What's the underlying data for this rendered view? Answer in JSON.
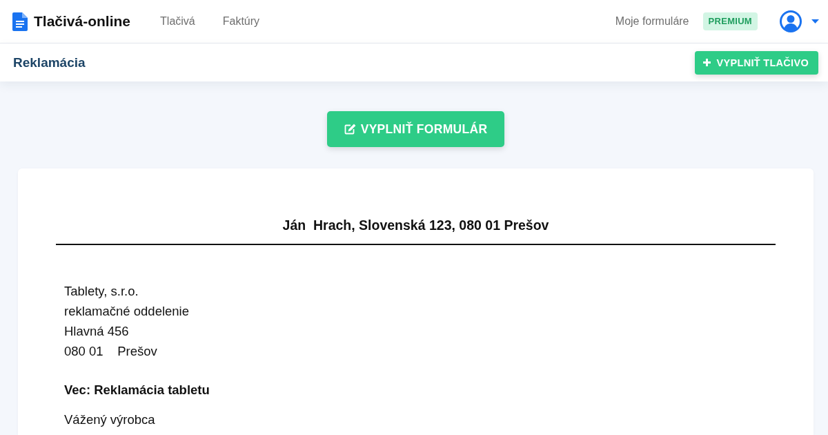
{
  "navbar": {
    "brand": "Tlačivá-online",
    "links": [
      {
        "label": "Tlačivá"
      },
      {
        "label": "Faktúry"
      }
    ],
    "my_forms": "Moje formuláre",
    "badge": "PREMIUM"
  },
  "subheader": {
    "title": "Reklamácia",
    "button": "VYPLNIŤ TLAČIVO"
  },
  "fill_button": "VYPLNIŤ FORMULÁR",
  "document": {
    "sender": "Ján  Hrach, Slovenská 123, 080 01 Prešov",
    "recipient": [
      "Tablety, s.r.o.",
      "reklamačné oddelenie",
      "Hlavná 456",
      "080 01    Prešov"
    ],
    "subject": "Vec: Reklamácia tabletu",
    "salutation": "Vážený výrobca"
  }
}
